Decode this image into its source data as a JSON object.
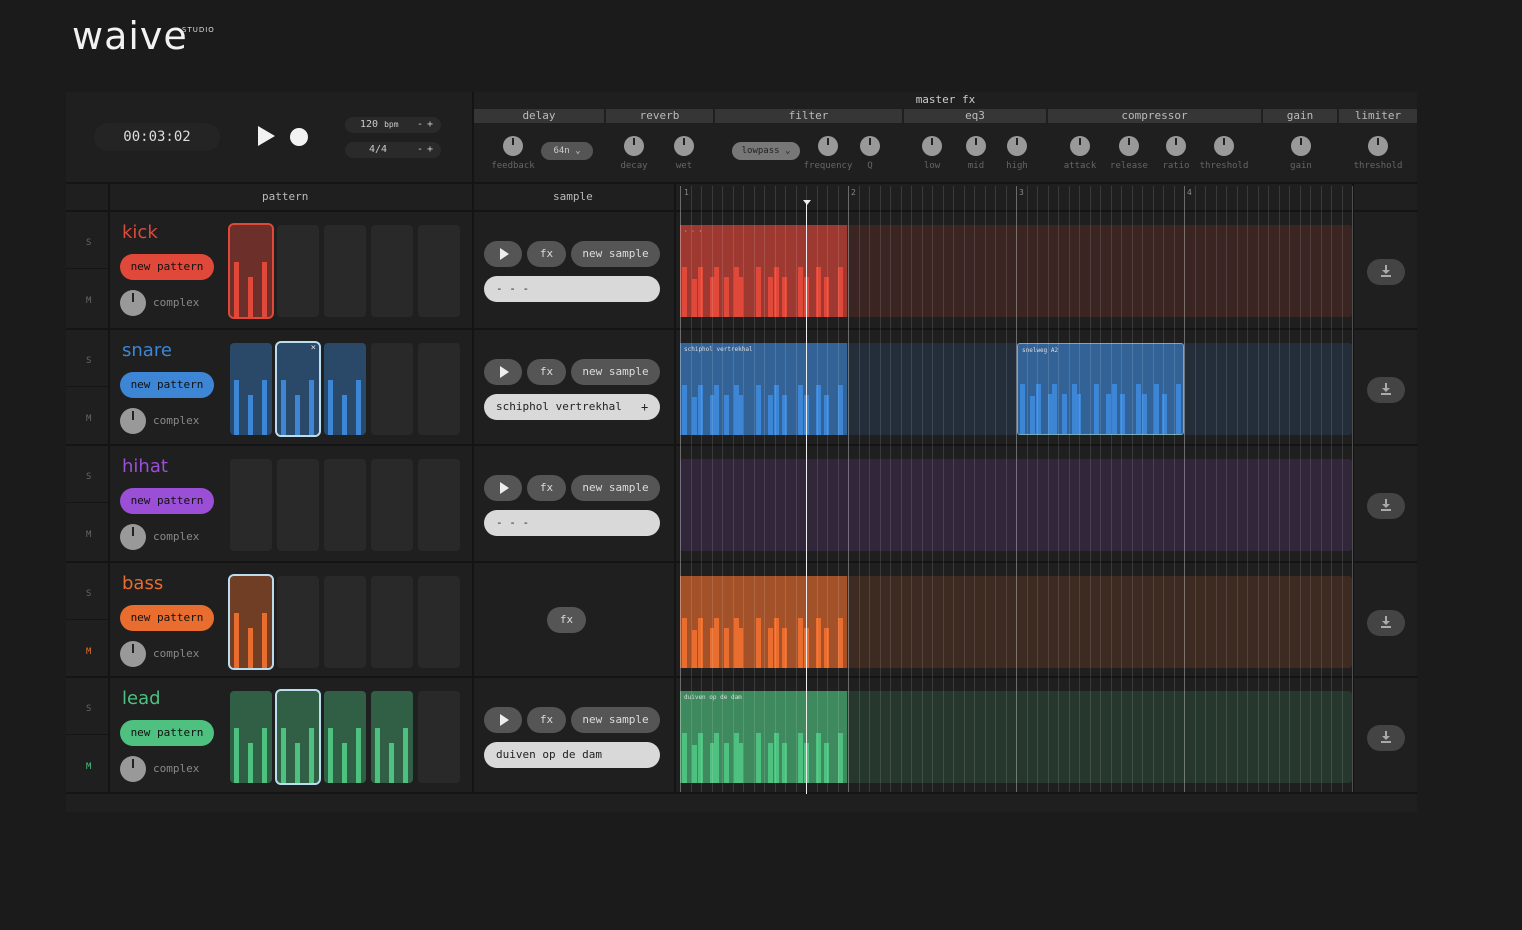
{
  "logo": {
    "text": "waive",
    "sub": "STUDIO"
  },
  "transport": {
    "time": "00:03:02",
    "bpm": "120",
    "bpm_unit": "bpm",
    "sig": "4/4",
    "minus": "-",
    "plus": "+"
  },
  "master_fx": {
    "title": "master fx",
    "sections": [
      {
        "name": "delay"
      },
      {
        "name": "reverb"
      },
      {
        "name": "filter"
      },
      {
        "name": "eq3"
      },
      {
        "name": "compressor"
      },
      {
        "name": "gain"
      },
      {
        "name": "limiter"
      }
    ],
    "knobs": [
      "feedback",
      "decay",
      "wet",
      "frequency",
      "Q",
      "low",
      "mid",
      "high",
      "attack",
      "release",
      "ratio",
      "threshold",
      "gain",
      "threshold"
    ],
    "delay_time": "64n",
    "filter_type": "lowpass"
  },
  "columns": {
    "pattern": "pattern",
    "sample": "sample"
  },
  "timeline": {
    "bars": [
      "1",
      "2",
      "3",
      "4"
    ]
  },
  "labels": {
    "solo": "S",
    "mute": "M",
    "new_pattern": "new pattern",
    "complex": "complex",
    "fx": "fx",
    "new_sample": "new sample",
    "add": "+",
    "close": "×"
  },
  "tracks": [
    {
      "name": "kick",
      "color": "#e0483a",
      "sample": "- - -",
      "clip_label": "· · ·",
      "muted": false
    },
    {
      "name": "snare",
      "color": "#3d86d6",
      "sample": "schiphol vertrekhal",
      "clip_label": "schiphol vertrekhal",
      "clip2_label": "snelweg A2",
      "muted": false
    },
    {
      "name": "hihat",
      "color": "#9a4fd6",
      "sample": "- - -",
      "muted": false
    },
    {
      "name": "bass",
      "color": "#e86d2e",
      "sample": "",
      "muted": true
    },
    {
      "name": "lead",
      "color": "#4ec07f",
      "sample": "duiven op de dam",
      "clip_label": "duiven op de dam",
      "muted": true
    }
  ],
  "colors": {
    "bg": "#1b1b1b",
    "panel": "#1f1f1f",
    "kick": "#e0483a",
    "snare": "#3d86d6",
    "hihat": "#9a4fd6",
    "bass": "#e86d2e",
    "lead": "#4ec07f"
  }
}
